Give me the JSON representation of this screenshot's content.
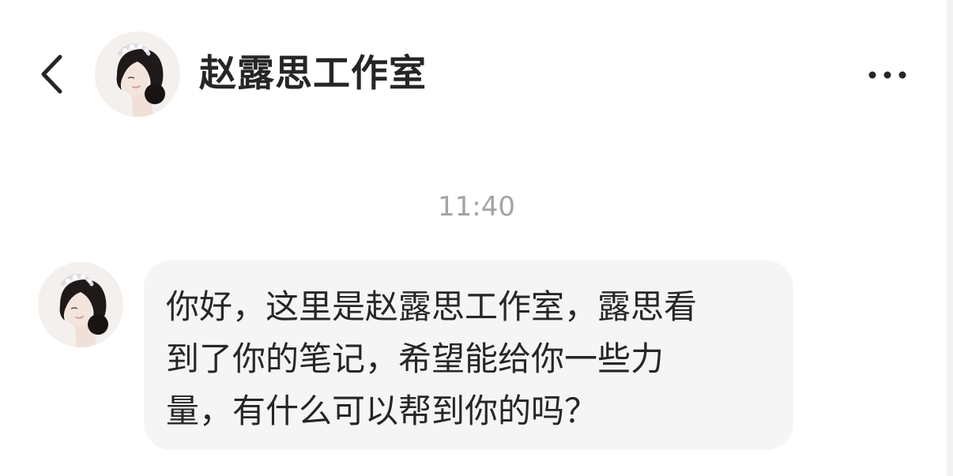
{
  "header": {
    "back_icon": "chevron-left-icon",
    "avatar_icon": "profile-avatar",
    "title": "赵露思工作室",
    "more_icon": "more-horizontal-icon"
  },
  "chat": {
    "timestamp": "11:40",
    "messages": [
      {
        "sender_avatar_icon": "profile-avatar",
        "lines": [
          "你好，这里是赵露思工作室，露思看",
          "到了你的笔记，希望能给你一些力",
          "量，有什么可以帮到你的吗？"
        ]
      }
    ]
  },
  "colors": {
    "background": "#ffffff",
    "bubble": "#f5f5f5",
    "text": "#262626",
    "timestamp": "#a3a3a3"
  }
}
